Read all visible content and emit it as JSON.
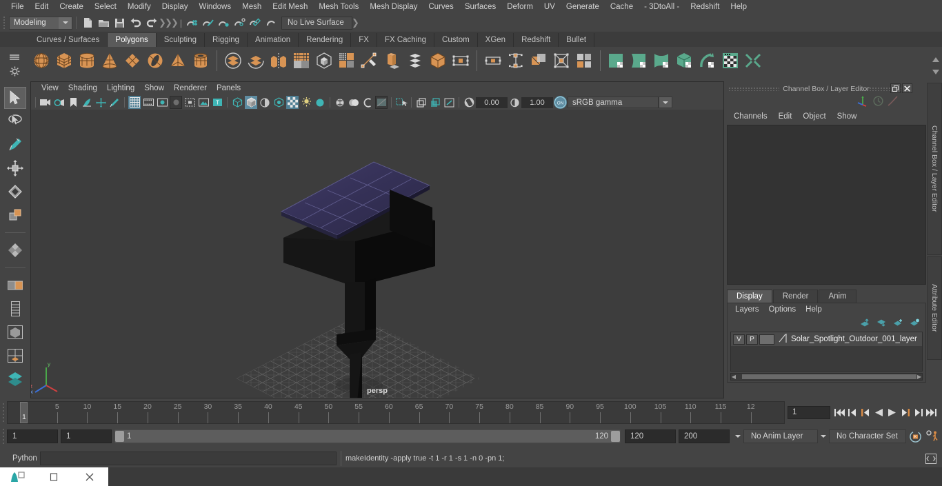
{
  "menubar": {
    "items": [
      "File",
      "Edit",
      "Create",
      "Select",
      "Modify",
      "Display",
      "Windows",
      "Mesh",
      "Edit Mesh",
      "Mesh Tools",
      "Mesh Display",
      "Curves",
      "Surfaces",
      "Deform",
      "UV",
      "Generate",
      "Cache",
      "- 3DtoAll -",
      "Redshift",
      "Help"
    ]
  },
  "statusline": {
    "mode": "Modeling",
    "live_surface": "No Live Surface",
    "icons": [
      "new-scene-icon",
      "open-scene-icon",
      "save-scene-icon",
      "undo-icon",
      "redo-icon",
      "snap-to-grid-icon",
      "snap-to-curve-icon",
      "snap-to-point-icon",
      "snap-to-projected-center-icon",
      "snap-to-view-plane-icon",
      "make-live-icon"
    ]
  },
  "shelf": {
    "tabs": [
      "Curves / Surfaces",
      "Polygons",
      "Sculpting",
      "Rigging",
      "Animation",
      "Rendering",
      "FX",
      "FX Caching",
      "Custom",
      "XGen",
      "Redshift",
      "Bullet"
    ],
    "active_tab": "Polygons",
    "icons": [
      "poly-sphere-icon",
      "poly-cube-icon",
      "poly-cylinder-icon",
      "poly-cone-icon",
      "poly-plane-icon",
      "poly-torus-icon",
      "poly-pyramid-icon",
      "poly-pipe-icon",
      "combine-icon",
      "separate-icon",
      "mirror-geometry-icon",
      "smooth-icon",
      "boolean-icon",
      "multi-cut-icon",
      "target-weld-icon",
      "extrude-icon",
      "bevel-icon",
      "bridge-icon",
      "append-polygon-icon",
      "wedge-face-icon",
      "poke-face-icon",
      "connect-icon",
      "sculpt-icon",
      "quad-draw-icon",
      "crease-icon",
      "uv-editor-icon",
      "uv-planar-icon",
      "uv-cylindrical-icon",
      "uv-automatic-icon",
      "uv-unfold-icon",
      "uv-layout-icon",
      "uv-cut-icon"
    ]
  },
  "toolbox": {
    "items": [
      "select-tool-icon",
      "lasso-select-tool-icon",
      "paint-select-tool-icon",
      "move-tool-icon",
      "rotate-tool-icon",
      "scale-tool-icon",
      "last-tool-icon",
      "snap-settings-icon",
      "outliner-layout-icon",
      "persp-layout-icon",
      "four-view-layout-icon",
      "hypergraph-layout-icon"
    ]
  },
  "viewport": {
    "menus": [
      "View",
      "Shading",
      "Lighting",
      "Show",
      "Renderer",
      "Panels"
    ],
    "exposure": "0.00",
    "gamma": "1.00",
    "color_space": "sRGB gamma",
    "view_label": "persp",
    "toolbar_icons": [
      "select-camera-icon",
      "camera-attributes-icon",
      "bookmark-icon",
      "image-plane-icon",
      "2d-pan-zoom-icon",
      "grease-pencil-icon",
      "grid-icon",
      "film-gate-icon",
      "resolution-gate-icon",
      "gate-mask-icon",
      "film-origin-icon",
      "exposure-icon",
      "xray-icon",
      "wireframe-icon",
      "smooth-shade-icon",
      "shaded-wireframe-icon",
      "textured-icon",
      "use-lights-icon",
      "shadows-icon",
      "screen-space-ao-icon",
      "motion-blur-icon",
      "anti-alias-icon",
      "multisample-icon",
      "isolate-select-icon",
      "xray-joints-icon",
      "xray-active-components-icon",
      "exposure-gamma-icon"
    ],
    "axis_labels": [
      "y",
      "x",
      "z"
    ]
  },
  "channelbox": {
    "panel_title": "Channel Box / Layer Editor",
    "menus": [
      "Channels",
      "Edit",
      "Object",
      "Show"
    ],
    "tool_icons": [
      "axis-marker-icon",
      "clock-icon",
      "curve-icon"
    ],
    "win_buttons": [
      "undock-icon",
      "close-icon"
    ]
  },
  "layer_editor": {
    "tabs": [
      "Display",
      "Render",
      "Anim"
    ],
    "active_tab": "Display",
    "menus": [
      "Layers",
      "Options",
      "Help"
    ],
    "buttons": [
      "move-layer-up-icon",
      "move-layer-down-icon",
      "new-layer-icon",
      "new-layer-from-selected-icon"
    ],
    "layers": [
      {
        "visibility": "V",
        "playback": "P",
        "name": "Solar_Spotlight_Outdoor_001_layer"
      }
    ]
  },
  "side_tabs": [
    "Channel Box / Layer Editor",
    "Attribute Editor"
  ],
  "timeline": {
    "start": 1,
    "end": 120,
    "current": "1",
    "tick_labels": [
      "5",
      "10",
      "15",
      "20",
      "25",
      "30",
      "35",
      "40",
      "45",
      "50",
      "55",
      "60",
      "65",
      "70",
      "75",
      "80",
      "85",
      "90",
      "95",
      "100",
      "105",
      "110",
      "115",
      "12"
    ],
    "current_frame_field": "1",
    "playback_icons": [
      "go-to-start-icon",
      "step-back-frame-icon",
      "step-back-key-icon",
      "play-backwards-icon",
      "play-forwards-icon",
      "step-forward-key-icon",
      "step-forward-frame-icon",
      "go-to-end-icon"
    ]
  },
  "range": {
    "anim_start": "1",
    "range_start": "1",
    "slider_min": "1",
    "slider_max": "120",
    "range_end": "120",
    "anim_end": "200",
    "anim_layer": "No Anim Layer",
    "character_set": "No Character Set",
    "right_icons": [
      "auto-key-icon",
      "animation-preferences-icon"
    ]
  },
  "command_line": {
    "language_label": "Python",
    "input_value": "",
    "result": "makeIdentity -apply true -t 1 -r 1 -s 1 -n 0 -pn 1;",
    "script_editor_icon": "script-editor-icon"
  },
  "taskbar": {
    "items": [
      "maya-app-icon",
      "minimize-icon",
      "close-icon"
    ]
  },
  "colors": {
    "bg": "#444444",
    "panel_bg": "#3b3b3b",
    "accent_teal": "#4f9aa8",
    "accent_orange": "#d98b45",
    "shelf_poly_orange": "#d89454",
    "shelf_uv_green": "#5aa98c",
    "highlight_blue": "#5e8ca1",
    "text": "#c8c8c8"
  }
}
